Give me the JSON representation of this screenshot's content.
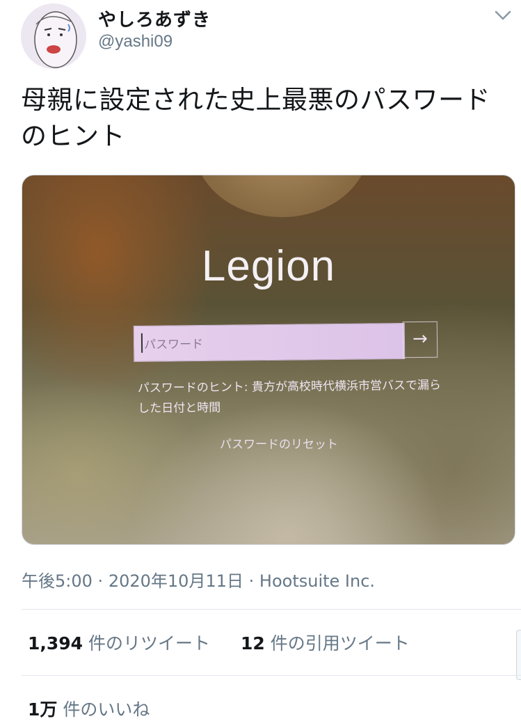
{
  "user": {
    "display_name": "やしろあずき",
    "handle": "@yashi09"
  },
  "tweet": {
    "text": "母親に設定された史上最悪のパスワードのヒント",
    "photo": {
      "brand": "Legion",
      "password_placeholder": "パスワード",
      "hint": "パスワードのヒント: 貴方が高校時代横浜市営バスで漏らした日付と時間",
      "reset_link": "パスワードのリセット",
      "submit_arrow": "→"
    },
    "meta": {
      "time": "午後5:00",
      "separator": "·",
      "date": "2020年10月11日",
      "source": "Hootsuite Inc."
    },
    "stats": {
      "retweets_count": "1,394",
      "retweets_label": "件のリツイート",
      "quotes_count": "12",
      "quotes_label": "件の引用ツイート",
      "likes_count": "1万",
      "likes_label": "件のいいね"
    }
  },
  "icons": {
    "caret": "chevron-down-icon",
    "avatar": "avatar-illustration"
  }
}
